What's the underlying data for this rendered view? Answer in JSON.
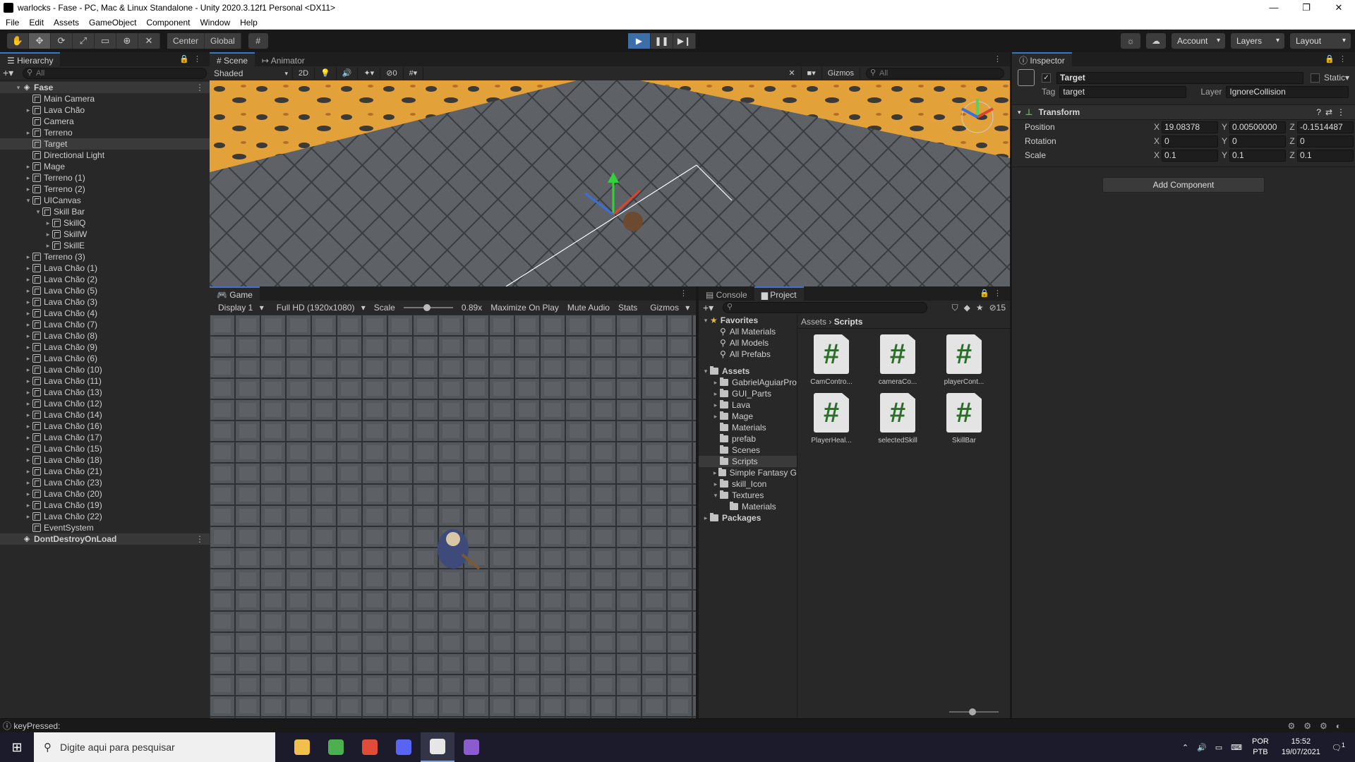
{
  "window": {
    "title": "warlocks - Fase - PC, Mac & Linux Standalone - Unity 2020.3.12f1 Personal <DX11>",
    "controls": [
      "—",
      "❐",
      "✕"
    ]
  },
  "menu": [
    "File",
    "Edit",
    "Assets",
    "GameObject",
    "Component",
    "Window",
    "Help"
  ],
  "toolbar": {
    "pivot_center": "Center",
    "pivot_global": "Global",
    "account": "Account",
    "layers": "Layers",
    "layout": "Layout"
  },
  "hierarchy": {
    "tab": "Hierarchy",
    "search_placeholder": "All",
    "items": [
      {
        "label": "Fase",
        "depth": 0,
        "type": "scene",
        "expanded": true
      },
      {
        "label": "Main Camera",
        "depth": 1
      },
      {
        "label": "Lava Chão",
        "depth": 1,
        "children": true
      },
      {
        "label": "Camera",
        "depth": 1
      },
      {
        "label": "Terreno",
        "depth": 1,
        "children": true
      },
      {
        "label": "Target",
        "depth": 1,
        "selected": true
      },
      {
        "label": "Directional Light",
        "depth": 1
      },
      {
        "label": "Mage",
        "depth": 1,
        "children": true
      },
      {
        "label": "Terreno (1)",
        "depth": 1,
        "children": true
      },
      {
        "label": "Terreno (2)",
        "depth": 1,
        "children": true
      },
      {
        "label": "UICanvas",
        "depth": 1,
        "expanded": true
      },
      {
        "label": "Skill Bar",
        "depth": 2,
        "expanded": true
      },
      {
        "label": "SkillQ",
        "depth": 3,
        "children": true
      },
      {
        "label": "SkillW",
        "depth": 3,
        "children": true
      },
      {
        "label": "SkillE",
        "depth": 3,
        "children": true
      },
      {
        "label": "Terreno (3)",
        "depth": 1,
        "children": true
      },
      {
        "label": "Lava Chão (1)",
        "depth": 1,
        "children": true
      },
      {
        "label": "Lava Chão (2)",
        "depth": 1,
        "children": true
      },
      {
        "label": "Lava Chão (5)",
        "depth": 1,
        "children": true
      },
      {
        "label": "Lava Chão (3)",
        "depth": 1,
        "children": true
      },
      {
        "label": "Lava Chão (4)",
        "depth": 1,
        "children": true
      },
      {
        "label": "Lava Chão (7)",
        "depth": 1,
        "children": true
      },
      {
        "label": "Lava Chão (8)",
        "depth": 1,
        "children": true
      },
      {
        "label": "Lava Chão (9)",
        "depth": 1,
        "children": true
      },
      {
        "label": "Lava Chão (6)",
        "depth": 1,
        "children": true
      },
      {
        "label": "Lava Chão (10)",
        "depth": 1,
        "children": true
      },
      {
        "label": "Lava Chão (11)",
        "depth": 1,
        "children": true
      },
      {
        "label": "Lava Chão (13)",
        "depth": 1,
        "children": true
      },
      {
        "label": "Lava Chão (12)",
        "depth": 1,
        "children": true
      },
      {
        "label": "Lava Chão (14)",
        "depth": 1,
        "children": true
      },
      {
        "label": "Lava Chão (16)",
        "depth": 1,
        "children": true
      },
      {
        "label": "Lava Chão (17)",
        "depth": 1,
        "children": true
      },
      {
        "label": "Lava Chão (15)",
        "depth": 1,
        "children": true
      },
      {
        "label": "Lava Chão (18)",
        "depth": 1,
        "children": true
      },
      {
        "label": "Lava Chão (21)",
        "depth": 1,
        "children": true
      },
      {
        "label": "Lava Chão (23)",
        "depth": 1,
        "children": true
      },
      {
        "label": "Lava Chão (20)",
        "depth": 1,
        "children": true
      },
      {
        "label": "Lava Chão (19)",
        "depth": 1,
        "children": true
      },
      {
        "label": "Lava Chão (22)",
        "depth": 1,
        "children": true
      },
      {
        "label": "EventSystem",
        "depth": 1
      },
      {
        "label": "DontDestroyOnLoad",
        "depth": 0,
        "type": "scene",
        "expanded": false
      }
    ]
  },
  "scene": {
    "tab_scene": "Scene",
    "tab_animator": "Animator",
    "shading": "Shaded",
    "mode_2d": "2D",
    "hidden_count": "0",
    "gizmos": "Gizmos",
    "search_placeholder": "All"
  },
  "game": {
    "tab": "Game",
    "display": "Display 1",
    "resolution": "Full HD (1920x1080)",
    "scale_label": "Scale",
    "scale_value": "0.89x",
    "maximize": "Maximize On Play",
    "mute": "Mute Audio",
    "stats": "Stats",
    "gizmos": "Gizmos"
  },
  "project": {
    "tab_console": "Console",
    "tab_project": "Project",
    "hidden_count": "15",
    "favorites_label": "Favorites",
    "favorites": [
      "All Materials",
      "All Models",
      "All Prefabs"
    ],
    "assets_label": "Assets",
    "folders": [
      {
        "label": "GabrielAguiarPro",
        "depth": 1,
        "children": true
      },
      {
        "label": "GUI_Parts",
        "depth": 1,
        "children": true
      },
      {
        "label": "Lava",
        "depth": 1,
        "children": true
      },
      {
        "label": "Mage",
        "depth": 1,
        "children": true
      },
      {
        "label": "Materials",
        "depth": 1
      },
      {
        "label": "prefab",
        "depth": 1
      },
      {
        "label": "Scenes",
        "depth": 1
      },
      {
        "label": "Scripts",
        "depth": 1,
        "selected": true
      },
      {
        "label": "Simple Fantasy G",
        "depth": 1,
        "children": true
      },
      {
        "label": "skill_Icon",
        "depth": 1,
        "children": true
      },
      {
        "label": "Textures",
        "depth": 1,
        "expanded": true
      },
      {
        "label": "Materials",
        "depth": 2
      }
    ],
    "packages_label": "Packages",
    "breadcrumb_root": "Assets",
    "breadcrumb_current": "Scripts",
    "assets": [
      "CamContro...",
      "cameraCo...",
      "playerCont...",
      "PlayerHeal...",
      "selectedSkill",
      "SkillBar"
    ]
  },
  "inspector": {
    "tab": "Inspector",
    "object_name": "Target",
    "static_label": "Static",
    "tag_label": "Tag",
    "tag_value": "target",
    "layer_label": "Layer",
    "layer_value": "IgnoreCollision",
    "component": "Transform",
    "position": {
      "label": "Position",
      "x": "19.08378",
      "y": "0.00500000",
      "z": "-0.1514487"
    },
    "rotation": {
      "label": "Rotation",
      "x": "0",
      "y": "0",
      "z": "0"
    },
    "scale": {
      "label": "Scale",
      "x": "0.1",
      "y": "0.1",
      "z": "0.1"
    },
    "add_component": "Add Component"
  },
  "status": {
    "text": "keyPressed:"
  },
  "taskbar": {
    "search_placeholder": "Digite aqui para pesquisar",
    "lang_1": "POR",
    "lang_2": "PTB",
    "time": "15:52",
    "date": "19/07/2021",
    "notification_count": "1",
    "apps": [
      {
        "name": "file-explorer-app",
        "color": "#f1c04c"
      },
      {
        "name": "notepad-app",
        "color": "#4caf50"
      },
      {
        "name": "chrome-app",
        "color": "#e04b3a"
      },
      {
        "name": "discord-app",
        "color": "#5865f2"
      },
      {
        "name": "unity-app",
        "color": "#e6e6e6"
      },
      {
        "name": "visual-studio-app",
        "color": "#8a5cd0"
      }
    ]
  },
  "colors": {
    "accent": "#3a76c4",
    "play_active": "#3c6ea8",
    "lava": "#e9a33a",
    "tile": "#5a5e63",
    "script_hash": "#2a6e2a"
  }
}
